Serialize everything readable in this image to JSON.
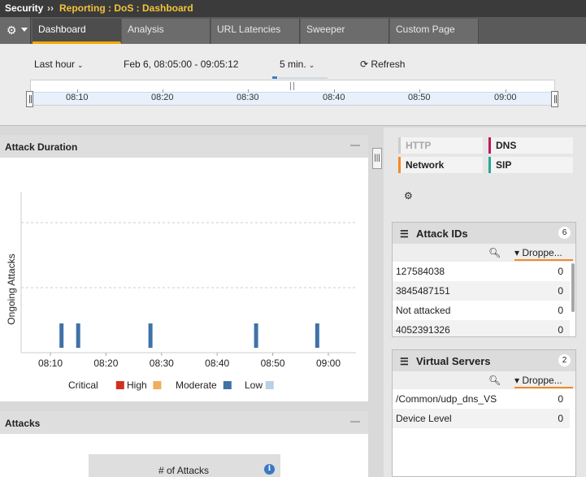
{
  "breadcrumb": {
    "section": "Security",
    "separator": "››",
    "path": "Reporting : DoS : Dashboard"
  },
  "tabs": [
    {
      "label": "Dashboard",
      "active": true
    },
    {
      "label": "Analysis"
    },
    {
      "label": "URL Latencies"
    },
    {
      "label": "Sweeper"
    },
    {
      "label": "Custom Page"
    }
  ],
  "timebar": {
    "period": "Last hour",
    "range": "Feb 6, 08:05:00 - 09:05:12",
    "interval": "5 min.",
    "refresh": "Refresh",
    "ticks": [
      "08:10",
      "08:20",
      "08:30",
      "08:40",
      "08:50",
      "09:00"
    ]
  },
  "attack_duration": {
    "title": "Attack Duration"
  },
  "attacks_panel": {
    "title": "Attacks",
    "column": "# of Attacks"
  },
  "chart_data": {
    "type": "bar",
    "ylabel": "Ongoing Attacks",
    "xlabel": "",
    "x_ticks": [
      "08:10",
      "08:20",
      "08:30",
      "08:40",
      "08:50",
      "09:00"
    ],
    "legend": [
      {
        "name": "Critical",
        "color": "#d32f1e"
      },
      {
        "name": "High",
        "color": "#f0ad5c"
      },
      {
        "name": "Moderate",
        "color": "#3f72a8"
      },
      {
        "name": "Low",
        "color": "#b8d0e8"
      }
    ],
    "series": [
      {
        "name": "Moderate",
        "points": [
          {
            "x": "08:12",
            "y": 1
          },
          {
            "x": "08:15",
            "y": 1
          },
          {
            "x": "08:28",
            "y": 1
          },
          {
            "x": "08:47",
            "y": 1
          },
          {
            "x": "08:58",
            "y": 1
          }
        ]
      }
    ],
    "ylim": [
      0,
      3
    ],
    "grid": true
  },
  "protocols": [
    {
      "label": "HTTP",
      "color": "#cccccc",
      "disabled": true
    },
    {
      "label": "DNS",
      "color": "#c2185b"
    },
    {
      "label": "Network",
      "color": "#f08a24",
      "selected": true
    },
    {
      "label": "SIP",
      "color": "#26a69a"
    }
  ],
  "attack_ids": {
    "title": "Attack IDs",
    "count": "6",
    "sort_label": "Droppe...",
    "rows": [
      {
        "key": "127584038",
        "value": "0"
      },
      {
        "key": "3845487151",
        "value": "0"
      },
      {
        "key": "Not attacked",
        "value": "0"
      },
      {
        "key": "4052391326",
        "value": "0"
      }
    ]
  },
  "virtual_servers": {
    "title": "Virtual Servers",
    "count": "2",
    "sort_label": "Droppe...",
    "rows": [
      {
        "key": "/Common/udp_dns_VS",
        "value": "0"
      },
      {
        "key": "Device Level",
        "value": "0"
      }
    ]
  }
}
